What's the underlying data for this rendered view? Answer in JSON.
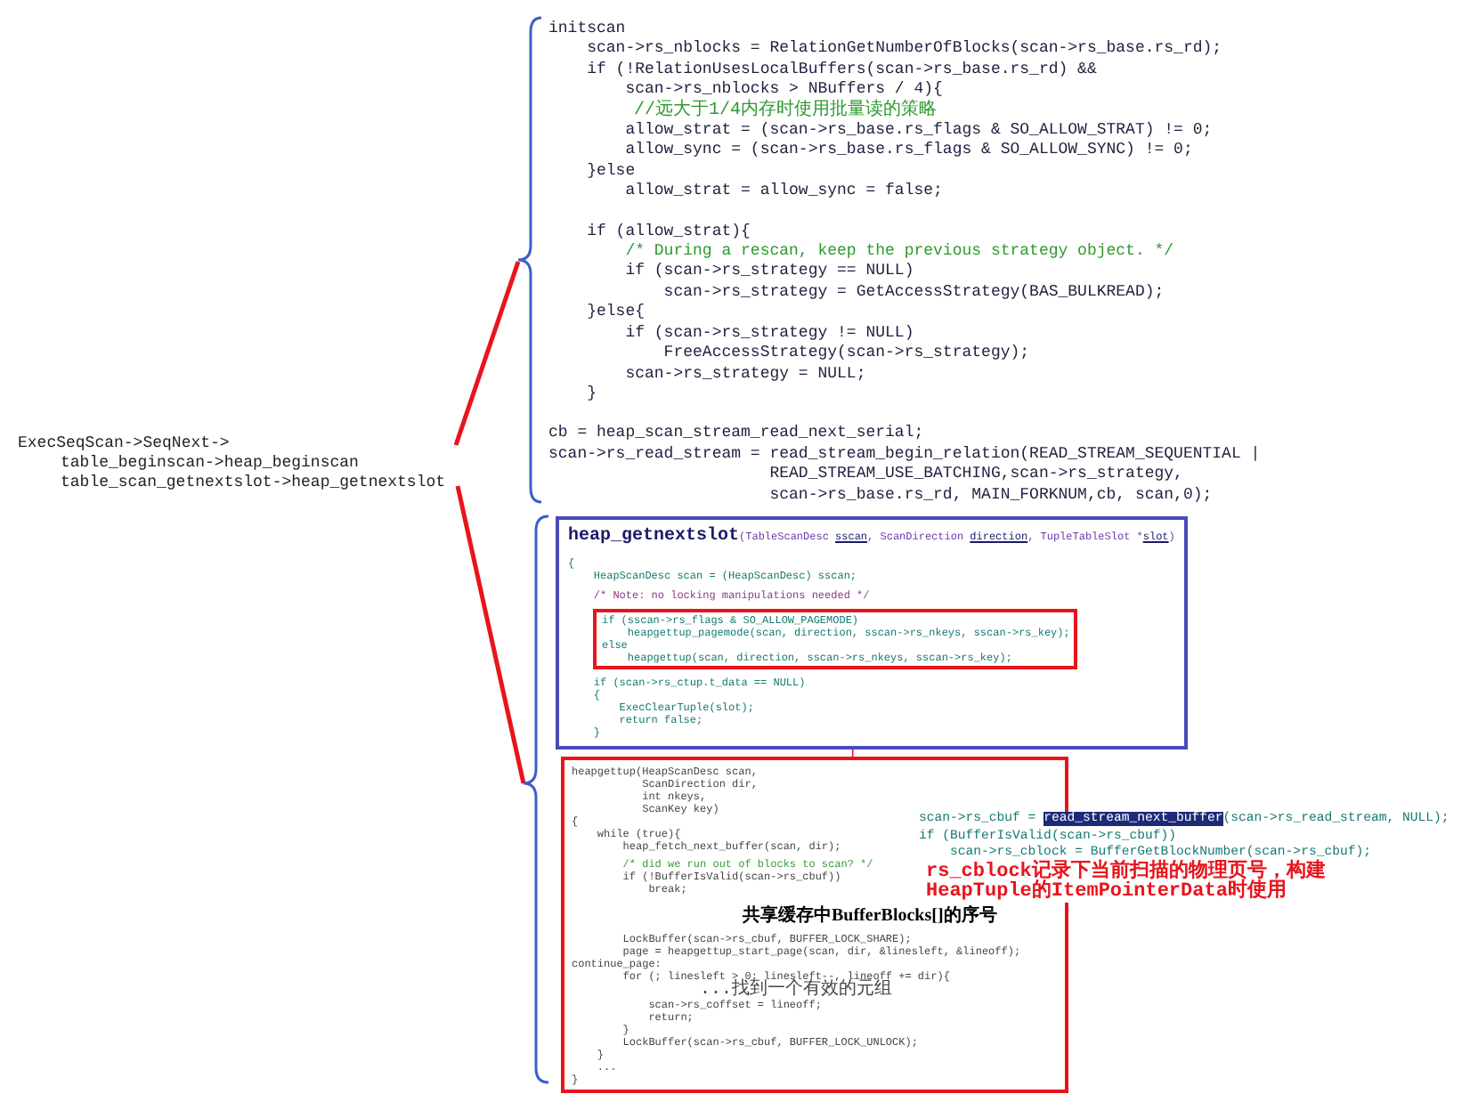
{
  "call_tree": {
    "text": "ExecSeqScan->SeqNext->",
    "children": [
      {
        "text": "table_beginscan->heap_beginscan"
      },
      {
        "text": "table_scan_getnextslot->heap_getnextslot"
      }
    ]
  },
  "initscan": {
    "blocks": [
      [
        {
          "text": "initscan",
          "kind": "code"
        },
        {
          "text": "    scan->rs_nblocks = RelationGetNumberOfBlocks(scan->rs_base.rs_rd);",
          "kind": "code"
        },
        {
          "text": "    if (!RelationUsesLocalBuffers(scan->rs_base.rs_rd) &&",
          "kind": "code"
        },
        {
          "text": "        scan->rs_nblocks > NBuffers / 4){",
          "kind": "code"
        },
        {
          "text": "        //远大于1/4内存时使用批量读的策略",
          "kind": "comment_cjk"
        },
        {
          "text": "        allow_strat = (scan->rs_base.rs_flags & SO_ALLOW_STRAT) != 0;",
          "kind": "code"
        },
        {
          "text": "        allow_sync = (scan->rs_base.rs_flags & SO_ALLOW_SYNC) != 0;",
          "kind": "code"
        },
        {
          "text": "    }else",
          "kind": "code"
        },
        {
          "text": "        allow_strat = allow_sync = false;",
          "kind": "code"
        }
      ],
      [
        {
          "text": "    if (allow_strat){",
          "kind": "code"
        },
        {
          "text": "        /* During a rescan, keep the previous strategy object. */",
          "kind": "comment"
        },
        {
          "text": "        if (scan->rs_strategy == NULL)",
          "kind": "code"
        },
        {
          "text": "            scan->rs_strategy = GetAccessStrategy(BAS_BULKREAD);",
          "kind": "code"
        },
        {
          "text": "    }else{",
          "kind": "code"
        },
        {
          "text": "        if (scan->rs_strategy != NULL)",
          "kind": "code"
        },
        {
          "text": "            FreeAccessStrategy(scan->rs_strategy);",
          "kind": "code"
        },
        {
          "text": "        scan->rs_strategy = NULL;",
          "kind": "code"
        },
        {
          "text": "    }",
          "kind": "code"
        }
      ],
      [
        {
          "text": "cb = heap_scan_stream_read_next_serial;",
          "kind": "code"
        },
        {
          "text": "scan->rs_read_stream = read_stream_begin_relation(READ_STREAM_SEQUENTIAL |",
          "kind": "code"
        },
        {
          "text": "                       READ_STREAM_USE_BATCHING,scan->rs_strategy,",
          "kind": "code"
        },
        {
          "text": "                       scan->rs_base.rs_rd, MAIN_FORKNUM,cb, scan,0);",
          "kind": "code"
        }
      ]
    ]
  },
  "getnextslot": {
    "title": "heap_getnextslot",
    "signature": [
      {
        "text": "(TableScanDesc ",
        "underlined": false
      },
      {
        "text": "sscan",
        "underlined": true
      },
      {
        "text": ", ScanDirection ",
        "underlined": false
      },
      {
        "text": "direction",
        "underlined": true
      },
      {
        "text": ", TupleTableSlot *",
        "underlined": false
      },
      {
        "text": "slot",
        "underlined": true
      },
      {
        "text": ")",
        "underlined": false
      }
    ],
    "blocks": [
      {
        "boxed": false,
        "lines": [
          {
            "text": "{",
            "kind": "code"
          },
          {
            "text": "    HeapScanDesc scan = (HeapScanDesc) sscan;",
            "kind": "code"
          }
        ]
      },
      {
        "boxed": false,
        "lines": [
          {
            "text": "    /* Note: no locking manipulations needed */",
            "kind": "comment"
          }
        ]
      },
      {
        "boxed": true,
        "lines": [
          {
            "text": "if (sscan->rs_flags & SO_ALLOW_PAGEMODE)",
            "kind": "code"
          },
          {
            "text": "    heapgettup_pagemode(scan, direction, sscan->rs_nkeys, sscan->rs_key);",
            "kind": "code"
          },
          {
            "text": "else",
            "kind": "code"
          },
          {
            "text": "    heapgettup(scan, direction, sscan->rs_nkeys, sscan->rs_key);",
            "kind": "code"
          }
        ]
      },
      {
        "boxed": false,
        "lines": [
          {
            "text": "    if (scan->rs_ctup.t_data == NULL)",
            "kind": "code"
          },
          {
            "text": "    {",
            "kind": "code"
          },
          {
            "text": "        ExecClearTuple(slot);",
            "kind": "code"
          },
          {
            "text": "        return false;",
            "kind": "code"
          },
          {
            "text": "    }",
            "kind": "code"
          }
        ]
      }
    ]
  },
  "heapgettup": {
    "blocks": [
      [
        {
          "text": "heapgettup(HeapScanDesc scan,",
          "kind": "code"
        },
        {
          "text": "           ScanDirection dir,",
          "kind": "code"
        },
        {
          "text": "           int nkeys,",
          "kind": "code"
        },
        {
          "text": "           ScanKey key)",
          "kind": "code"
        },
        {
          "text": "{",
          "kind": "code"
        },
        {
          "text": "    while (true){",
          "kind": "code"
        },
        {
          "text": "        heap_fetch_next_buffer(scan, dir);",
          "kind": "code"
        }
      ],
      [
        {
          "text": "        /* did we run out of blocks to scan? */",
          "kind": "comment"
        },
        {
          "text": "        if (!BufferIsValid(scan->rs_cbuf))",
          "kind": "code"
        },
        {
          "text": "            break;",
          "kind": "code"
        }
      ],
      [
        {
          "text": "        LockBuffer(scan->rs_cbuf, BUFFER_LOCK_SHARE);",
          "kind": "code"
        },
        {
          "text": "        page = heapgettup_start_page(scan, dir, &linesleft, &lineoff);",
          "kind": "code"
        },
        {
          "text": "continue_page:",
          "kind": "code"
        },
        {
          "text": "        for (; linesleft > 0; linesleft--, lineoff += dir){",
          "kind": "code"
        },
        {
          "text": "            ...找到一个有效的元组",
          "kind": "code_cjk"
        },
        {
          "text": "            scan->rs_coffset = lineoff;",
          "kind": "code"
        },
        {
          "text": "            return;",
          "kind": "code"
        },
        {
          "text": "        }",
          "kind": "code"
        },
        {
          "text": "        LockBuffer(scan->rs_cbuf, BUFFER_LOCK_UNLOCK);",
          "kind": "code"
        },
        {
          "text": "    }",
          "kind": "code"
        },
        {
          "text": "    ...",
          "kind": "code"
        },
        {
          "text": "}",
          "kind": "code"
        }
      ]
    ],
    "caption": "共享缓存中BufferBlocks[]的序号"
  },
  "annotation": {
    "lines": [
      [
        {
          "text": "scan->rs_cbuf = ",
          "highlighted": false
        },
        {
          "text": "read_stream_next_buffer",
          "highlighted": true
        },
        {
          "text": "(scan->rs_read_stream, NULL);",
          "highlighted": false
        }
      ],
      [
        {
          "text": "if (BufferIsValid(scan->rs_cbuf))",
          "highlighted": false
        }
      ],
      [
        {
          "text": "    scan->rs_cblock = BufferGetBlockNumber(scan->rs_cbuf);",
          "highlighted": false
        }
      ]
    ],
    "note": [
      "rs_cblock记录下当前扫描的物理页号，构建",
      "HeapTuple的ItemPointerData时使用"
    ]
  }
}
